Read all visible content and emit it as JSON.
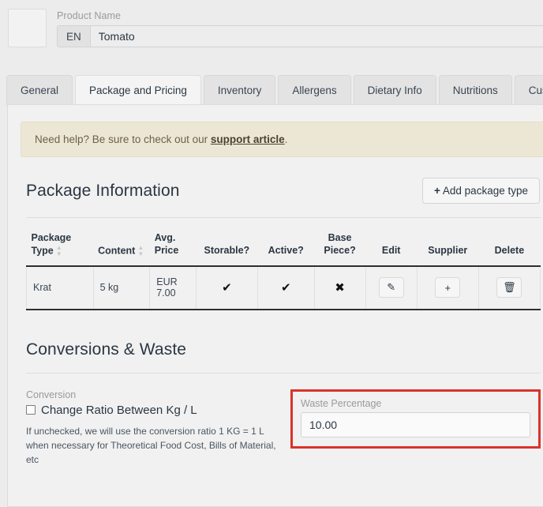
{
  "header": {
    "thumbnail_alt": "product-image-placeholder",
    "product_name_label": "Product Name",
    "language_code": "EN",
    "product_name_value": "Tomato"
  },
  "tabs": [
    {
      "label": "General",
      "active": false
    },
    {
      "label": "Package and Pricing",
      "active": true
    },
    {
      "label": "Inventory",
      "active": false
    },
    {
      "label": "Allergens",
      "active": false
    },
    {
      "label": "Dietary Info",
      "active": false
    },
    {
      "label": "Nutritions",
      "active": false
    },
    {
      "label": "Cus",
      "active": false
    }
  ],
  "alert": {
    "text_before": "Need help? Be sure to check out our ",
    "link": "support article",
    "text_after": "."
  },
  "package_section": {
    "title": "Package Information",
    "add_button": {
      "plus": "+",
      "label": "Add package type"
    },
    "columns": [
      {
        "label": "Package Type",
        "sortable": true,
        "align": "left"
      },
      {
        "label": "Content",
        "sortable": true,
        "align": "left"
      },
      {
        "label": "Avg. Price",
        "sortable": false,
        "align": "left"
      },
      {
        "label": "Storable?",
        "sortable": false,
        "align": "center"
      },
      {
        "label": "Active?",
        "sortable": false,
        "align": "center"
      },
      {
        "label": "Base Piece?",
        "sortable": false,
        "align": "center"
      },
      {
        "label": "Edit",
        "sortable": false,
        "align": "center"
      },
      {
        "label": "Supplier",
        "sortable": false,
        "align": "center"
      },
      {
        "label": "Delete",
        "sortable": false,
        "align": "center"
      }
    ],
    "rows": [
      {
        "package_type": "Krat",
        "content": "5 kg",
        "avg_price": "EUR 7.00",
        "storable": "✔",
        "active": "✔",
        "base_piece": "✖",
        "edit_icon": "✎",
        "supplier_icon": "+",
        "delete_icon": "🗑"
      }
    ]
  },
  "conversions_section": {
    "title": "Conversions & Waste",
    "conversion_label": "Conversion",
    "checkbox_label": "Change Ratio Between Kg / L",
    "checkbox_checked": false,
    "helper_text": "If unchecked, we will use the conversion ratio 1 KG = 1 L when necessary for Theoretical Food Cost, Bills of Material, etc",
    "waste_label": "Waste Percentage",
    "waste_value": "10.00",
    "highlight_color": "#d9342b"
  }
}
